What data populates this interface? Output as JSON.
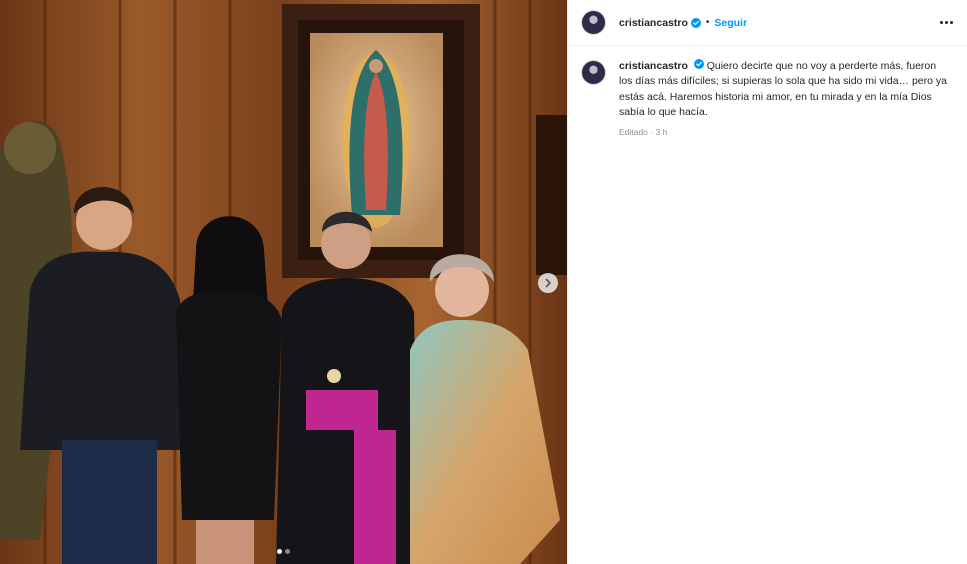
{
  "post": {
    "username": "cristiancastro",
    "follow_label": "Seguir",
    "separator": "•",
    "caption": "Quiero decirte que no voy a perderte más, fueron los días más difíciles; si supieras lo sola que ha sido mi vida… pero ya estás acá. Haremos historia mi amor, en tu mirada y en la mía Dios sabía lo que hacía.",
    "edited_label": "Editado",
    "meta_separator": "·",
    "time_ago": "3 h",
    "carousel": {
      "total_slides": 2,
      "active_slide": 1
    }
  },
  "icons": {
    "verified": "verified-badge-icon",
    "more": "more-options-icon",
    "next": "chevron-right-icon"
  },
  "colors": {
    "link": "#0095f6",
    "verified": "#0095f6",
    "text": "#262626",
    "muted": "#8e8e8e"
  }
}
